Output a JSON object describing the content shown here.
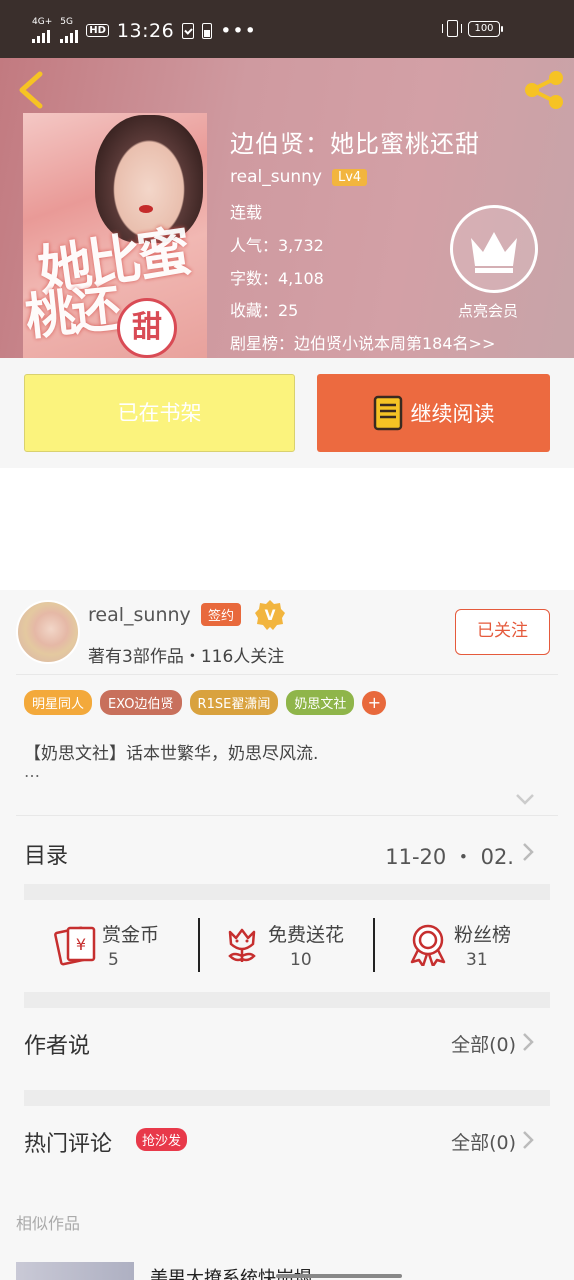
{
  "status_bar": {
    "net1": "4G+",
    "net2": "5G",
    "hd": "HD",
    "time": "13:26",
    "more": "•••",
    "battery": "100"
  },
  "book": {
    "title": "边伯贤：她比蜜桃还甜",
    "author": "real_sunny",
    "level": "Lv4",
    "status": "连载",
    "popularity": "人气：3,732",
    "word_count": "字数：4,108",
    "favorites": "收藏：25",
    "ranking": "剧星榜：边伯贤小说本周第184名>>",
    "vip_label": "点亮会员",
    "cover_text_1": "她比蜜",
    "cover_text_2": "桃还",
    "cover_circle": "甜"
  },
  "actions": {
    "shelf_label": "已在书架",
    "read_label": "继续阅读"
  },
  "author_card": {
    "name": "real_sunny",
    "sign_badge": "签约",
    "summary": "著有3部作品・116人关注",
    "follow_label": "已关注",
    "tags": [
      {
        "label": "明星同人",
        "color": "#f3a93b"
      },
      {
        "label": "EXO边伯贤",
        "color": "#c8705c"
      },
      {
        "label": "R1SE翟潇闻",
        "color": "#d9a23e"
      },
      {
        "label": "奶思文社",
        "color": "#8fb54a"
      }
    ],
    "tag_more": "+",
    "intro": "【奶思文社】话本世繁华，奶思尽风流.",
    "intro_more": "…"
  },
  "catalog": {
    "label": "目录",
    "date": "11-20 ・ 02."
  },
  "stats": [
    {
      "label": "赏金币",
      "value": "5",
      "icon": "red-envelope-icon"
    },
    {
      "label": "免费送花",
      "value": "10",
      "icon": "flower-icon"
    },
    {
      "label": "粉丝榜",
      "value": "31",
      "icon": "medal-icon"
    }
  ],
  "author_says": {
    "label": "作者说",
    "right": "全部(0)"
  },
  "hot_comments": {
    "label": "热门评论",
    "badge": "抢沙发",
    "right": "全部(0)"
  },
  "similar": {
    "label": "相似作品",
    "first_title": "美男大撩系统快崩塌"
  },
  "colors": {
    "accent": "#ec6a40",
    "shelf_button": "#fbf37d",
    "hero": "#cf9aa0"
  }
}
